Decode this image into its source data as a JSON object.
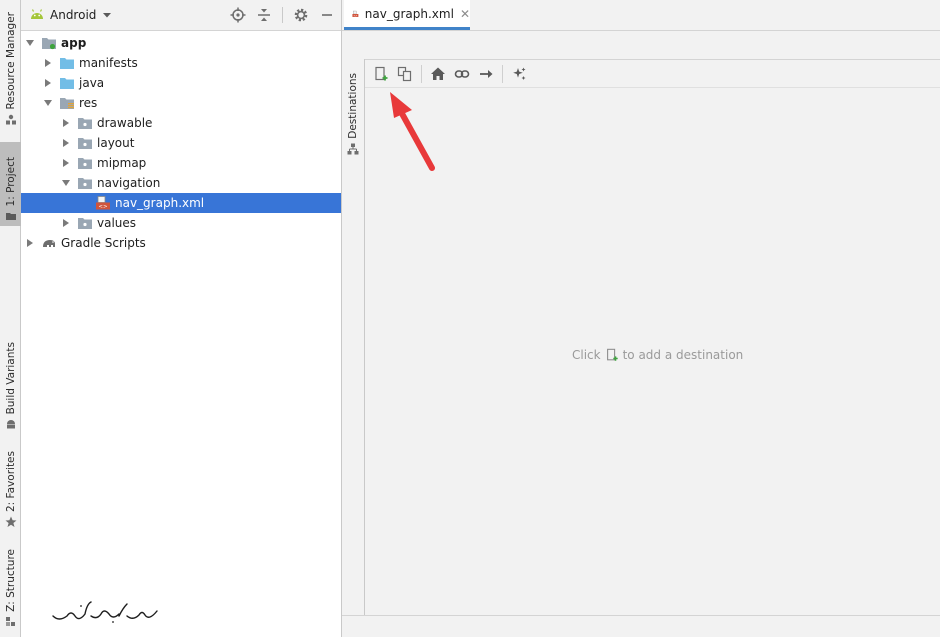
{
  "left_strip": {
    "tabs": [
      {
        "label": "Resource Manager",
        "icon": "resource-manager-icon"
      },
      {
        "label": "1: Project",
        "icon": "folder-icon"
      },
      {
        "label": "Build Variants",
        "icon": "android-icon"
      },
      {
        "label": "2: Favorites",
        "icon": "star-icon"
      },
      {
        "label": "Z: Structure",
        "icon": "structure-icon"
      }
    ]
  },
  "project_panel": {
    "view_selector": "Android",
    "tree": [
      {
        "label": "app",
        "expanded": true
      },
      {
        "label": "manifests",
        "expanded": false
      },
      {
        "label": "java",
        "expanded": false
      },
      {
        "label": "res",
        "expanded": true
      },
      {
        "label": "drawable",
        "expanded": false
      },
      {
        "label": "layout",
        "expanded": false
      },
      {
        "label": "mipmap",
        "expanded": false
      },
      {
        "label": "navigation",
        "expanded": true
      },
      {
        "label": "nav_graph.xml",
        "selected": true
      },
      {
        "label": "values",
        "expanded": false
      },
      {
        "label": "Gradle Scripts",
        "expanded": false
      }
    ]
  },
  "editor": {
    "tab_label": "nav_graph.xml",
    "destinations_label": "Destinations",
    "empty_before": "Click",
    "empty_after": "to add a destination"
  },
  "colors": {
    "selection": "#3875d7",
    "accent_green": "#3ea33e",
    "android_green": "#a4c639",
    "annotation_red": "#e8393a"
  }
}
